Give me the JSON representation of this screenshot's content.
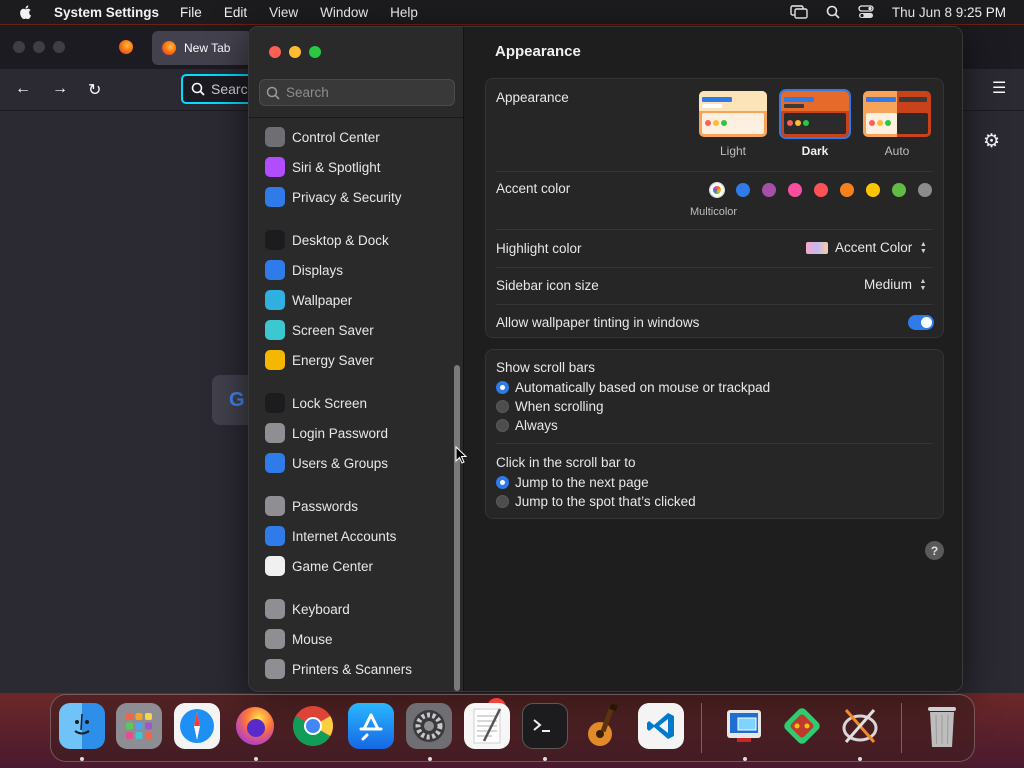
{
  "menubar": {
    "app_name": "System Settings",
    "menus": [
      "File",
      "Edit",
      "View",
      "Window",
      "Help"
    ],
    "clock": "Thu Jun 8  9:25 PM"
  },
  "browser": {
    "tab_title": "New Tab",
    "url_placeholder": "Searc"
  },
  "sidebar": {
    "search_placeholder": "Search",
    "items": [
      {
        "label": "Control Center",
        "icon": "control-center-icon",
        "color": "#6e6e73"
      },
      {
        "label": "Siri & Spotlight",
        "icon": "siri-icon",
        "color": "#b14cff"
      },
      {
        "label": "Privacy & Security",
        "icon": "hand-icon",
        "color": "#2f7bea"
      },
      {
        "label": "Desktop & Dock",
        "icon": "desktop-dock-icon",
        "color": "#1c1c1e"
      },
      {
        "label": "Displays",
        "icon": "displays-icon",
        "color": "#2f7bea"
      },
      {
        "label": "Wallpaper",
        "icon": "wallpaper-icon",
        "color": "#30b0e0"
      },
      {
        "label": "Screen Saver",
        "icon": "screen-saver-icon",
        "color": "#3cc8d0"
      },
      {
        "label": "Energy Saver",
        "icon": "energy-saver-icon",
        "color": "#f5b800"
      },
      {
        "label": "Lock Screen",
        "icon": "lock-screen-icon",
        "color": "#1c1c1e"
      },
      {
        "label": "Login Password",
        "icon": "login-password-icon",
        "color": "#8e8e93"
      },
      {
        "label": "Users & Groups",
        "icon": "users-groups-icon",
        "color": "#2f7bea"
      },
      {
        "label": "Passwords",
        "icon": "passwords-icon",
        "color": "#8e8e93"
      },
      {
        "label": "Internet Accounts",
        "icon": "internet-accounts-icon",
        "color": "#2f7bea"
      },
      {
        "label": "Game Center",
        "icon": "game-center-icon",
        "color": "#f0f0f0"
      },
      {
        "label": "Keyboard",
        "icon": "keyboard-icon",
        "color": "#8e8e93"
      },
      {
        "label": "Mouse",
        "icon": "mouse-icon",
        "color": "#8e8e93"
      },
      {
        "label": "Printers & Scanners",
        "icon": "printers-icon",
        "color": "#8e8e93"
      }
    ]
  },
  "main": {
    "title": "Appearance",
    "appearance": {
      "label": "Appearance",
      "options": [
        "Light",
        "Dark",
        "Auto"
      ],
      "selected": "Dark"
    },
    "accent": {
      "label": "Accent color",
      "colors": [
        "multicolor",
        "#2f7bea",
        "#a550a7",
        "#f74f9e",
        "#ff5257",
        "#f7821b",
        "#ffc600",
        "#62ba46",
        "#8c8c8c"
      ],
      "selected_caption": "Multicolor"
    },
    "highlight": {
      "label": "Highlight color",
      "value": "Accent Color"
    },
    "sidebar_icon_size": {
      "label": "Sidebar icon size",
      "value": "Medium"
    },
    "wallpaper_tinting": {
      "label": "Allow wallpaper tinting in windows",
      "on": true
    },
    "scroll_bars": {
      "label": "Show scroll bars",
      "options": [
        "Automatically based on mouse or trackpad",
        "When scrolling",
        "Always"
      ],
      "selected_index": 0
    },
    "click_scroll": {
      "label": "Click in the scroll bar to",
      "options": [
        "Jump to the next page",
        "Jump to the spot that’s clicked"
      ],
      "selected_index": 0
    },
    "help": "?"
  },
  "dock": {
    "apps": [
      "Finder",
      "Launchpad",
      "Safari",
      "Firefox",
      "Chrome",
      "App Store",
      "System Settings",
      "TextEdit",
      "Terminal",
      "GarageBand",
      "VS Code",
      "Remote Desktop",
      "Game",
      "Xcode Tools",
      "Trash"
    ],
    "settings_badge": "1"
  }
}
